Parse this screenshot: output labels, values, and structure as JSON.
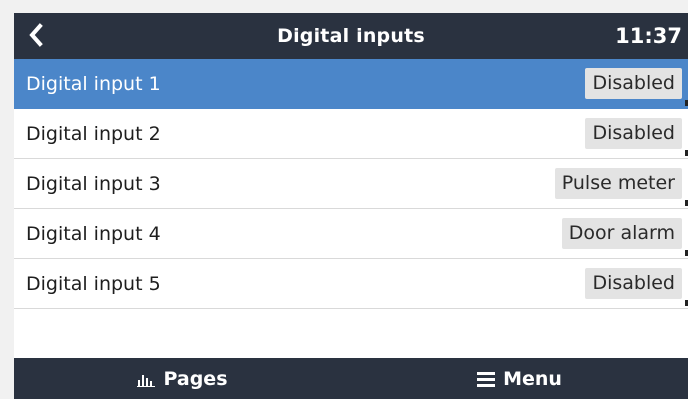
{
  "header": {
    "title": "Digital inputs",
    "time": "11:37",
    "back_icon": "chevron-left-icon"
  },
  "rows": [
    {
      "label": "Digital input 1",
      "value": "Disabled",
      "selected": true
    },
    {
      "label": "Digital input 2",
      "value": "Disabled",
      "selected": false
    },
    {
      "label": "Digital input 3",
      "value": "Pulse meter",
      "selected": false
    },
    {
      "label": "Digital input 4",
      "value": "Door alarm",
      "selected": false
    },
    {
      "label": "Digital input 5",
      "value": "Disabled",
      "selected": false
    }
  ],
  "footer": {
    "pages_label": "Pages",
    "pages_icon": "bar-chart-icon",
    "menu_label": "Menu",
    "menu_icon": "hamburger-icon"
  },
  "colors": {
    "header_bg": "#2a3240",
    "selected_row": "#4b86c9",
    "value_badge_bg": "#e3e3e3"
  }
}
